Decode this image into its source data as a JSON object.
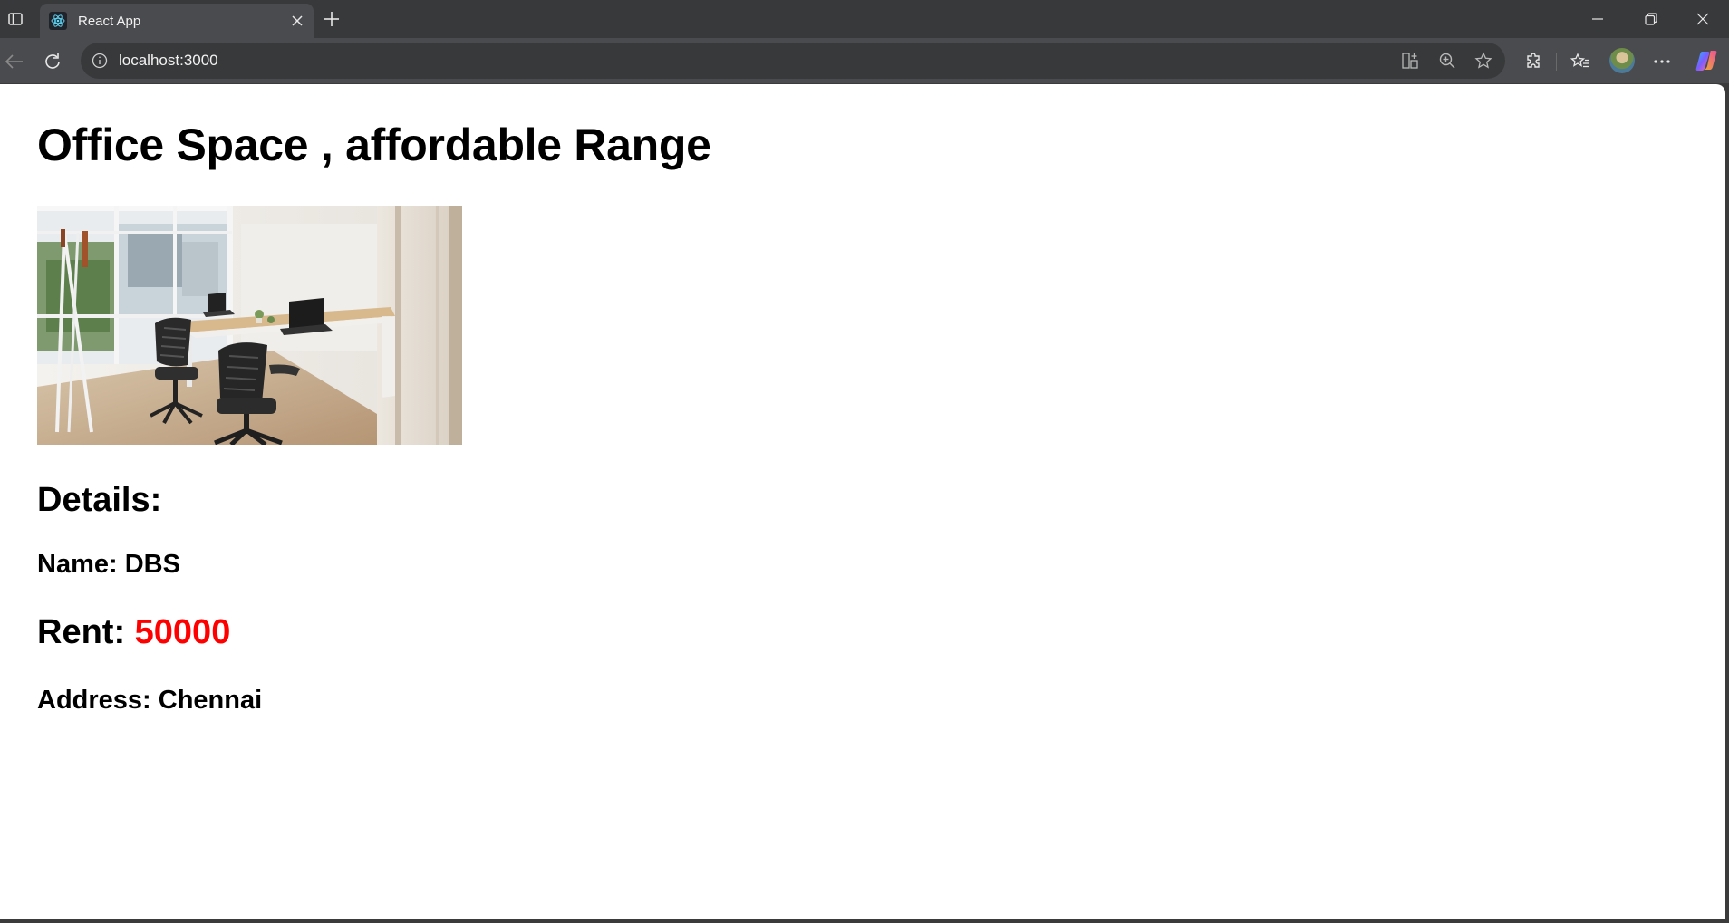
{
  "browser": {
    "tab": {
      "title": "React App",
      "favicon": "react-icon"
    },
    "address_bar": {
      "url": "localhost:3000"
    },
    "colors": {
      "chrome_dark": "#38393b",
      "chrome_toolbar": "#4a4b4e"
    }
  },
  "page": {
    "heading": "Office Space , affordable Range",
    "image": {
      "subject": "office-room-photo"
    },
    "details_heading": "Details:",
    "name_label": "Name: ",
    "name_value": "DBS",
    "rent_label": "Rent: ",
    "rent_value": "50000",
    "rent_color": "#ff0000",
    "address_label": "Address: ",
    "address_value": "Chennai"
  }
}
